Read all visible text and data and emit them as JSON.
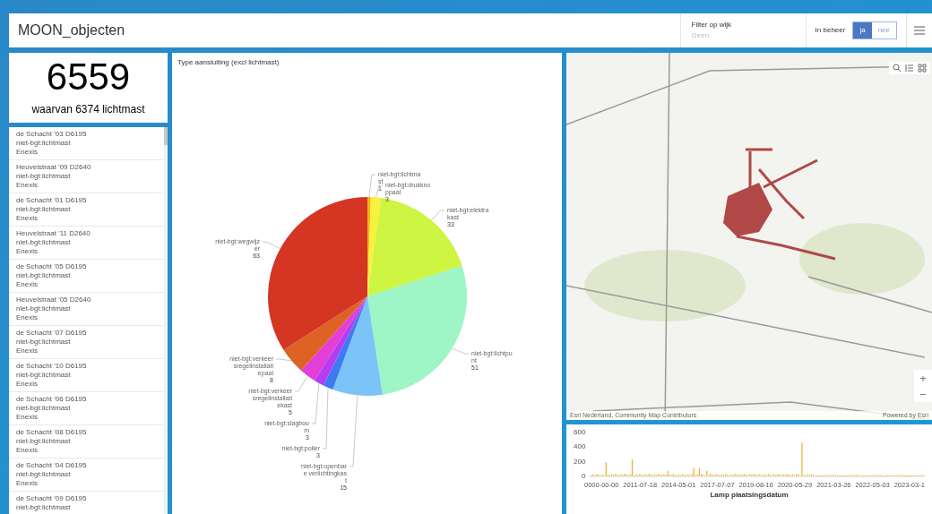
{
  "header": {
    "title": "MOON_objecten",
    "filter": {
      "label": "Filter op wijk",
      "placeholder": "Geen"
    },
    "toggle": {
      "label": "In beheer",
      "options": [
        {
          "label": "ja",
          "selected": true
        },
        {
          "label": "nee",
          "selected": false
        }
      ]
    }
  },
  "count": {
    "value": "6559",
    "caption": "waarvan 6374 lichtmast"
  },
  "list": [
    {
      "lines": [
        "de Schacht '03 D6195",
        "niet-bgt:lichtmast",
        "Enexis"
      ]
    },
    {
      "lines": [
        "Heuvelstraat '09 D2640",
        "niet-bgt:lichtmast",
        "Enexis"
      ]
    },
    {
      "lines": [
        "de Schacht '01 D6195",
        "niet-bgt:lichtmast",
        "Enexis"
      ]
    },
    {
      "lines": [
        "Heuvelstraat '11 D2640",
        "niet-bgt:lichtmast",
        "Enexis"
      ]
    },
    {
      "lines": [
        "de Schacht '05 D6195",
        "niet-bgt:lichtmast",
        "Enexis"
      ]
    },
    {
      "lines": [
        "Heuvelstraat '05 D2640",
        "niet-bgt:lichtmast",
        "Enexis"
      ]
    },
    {
      "lines": [
        "de Schacht '07 D6195",
        "niet-bgt:lichtmast",
        "Enexis"
      ]
    },
    {
      "lines": [
        "de Schacht '10 D6195",
        "niet-bgt:lichtmast",
        "Enexis"
      ]
    },
    {
      "lines": [
        "de Schacht '06 D6195",
        "niet-bgt:lichtmast",
        "Enexis"
      ]
    },
    {
      "lines": [
        "de Schacht '08 D6195",
        "niet-bgt:lichtmast",
        "Enexis"
      ]
    },
    {
      "lines": [
        "de Schacht '04 D6195",
        "niet-bgt:lichtmast",
        "Enexis"
      ]
    },
    {
      "lines": [
        "de Schacht '09 D6195",
        "niet-bgt:lichtmast"
      ]
    }
  ],
  "pie": {
    "chart_data": {
      "type": "pie",
      "title": "Type aansluiting (excl lichtmast)",
      "data_labels": true,
      "categories": [
        "niet-bgt:lichtmast",
        "niet-bgt:drukknoppaal",
        "niet-bgt:elektrakast",
        "niet-bgt:lichtpunt",
        "niet-bgt:openbare verlichtingkast",
        "niet-bgt:poller",
        "niet-bgt:slagboom",
        "niet-bgt:verkeersregelinstallatiekast",
        "niet-bgt:verkeersregelinstallatiepaal",
        "niet-bgt:wegwijzer"
      ],
      "values": [
        1,
        3,
        33,
        51,
        15,
        3,
        3,
        5,
        8,
        63
      ],
      "colors": [
        "#f2b21c",
        "#fbf03c",
        "#cdf542",
        "#9ef5c6",
        "#7cc3f7",
        "#3d7bf2",
        "#b33df2",
        "#e23fd6",
        "#dd6224",
        "#d53523"
      ]
    }
  },
  "map": {
    "attribution": "Esri Nederland, Community Map Contributors",
    "powered": "Powered by Esri",
    "zoom_in": "+",
    "zoom_out": "−"
  },
  "histogram": {
    "yticks": [
      "600",
      "400",
      "200",
      "0"
    ],
    "xticks": [
      "0000-00-00",
      "2011-07-18",
      "2014-05-01",
      "2017-07-07",
      "2019-08-16",
      "2020-05-29",
      "2021-03-26",
      "2022-05-03",
      "2023-03-1"
    ],
    "xlabel": "Lamp plaatsingsdatum"
  }
}
